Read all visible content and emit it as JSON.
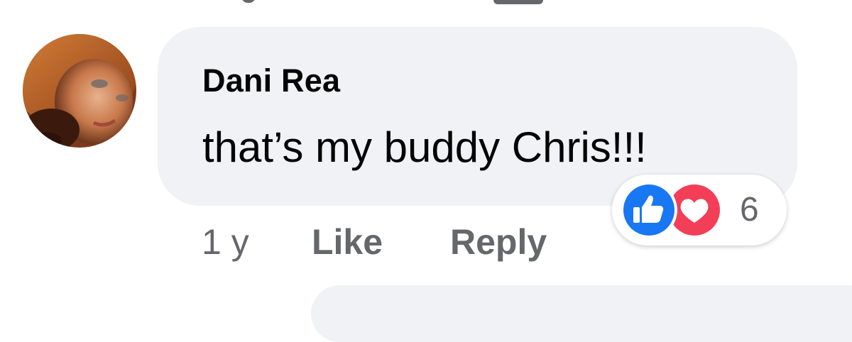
{
  "comment": {
    "author": "Dani Rea",
    "text": "that’s my buddy Chris!!!",
    "time": "1 y",
    "like_label": "Like",
    "reply_label": "Reply",
    "reactions": {
      "icons": [
        "like-icon",
        "love-icon"
      ],
      "count": "6"
    }
  },
  "colors": {
    "bubble": "#f0f2f5",
    "like_blue": "#1877f2",
    "love_red": "#f33e58",
    "secondary_text": "#65676b"
  }
}
